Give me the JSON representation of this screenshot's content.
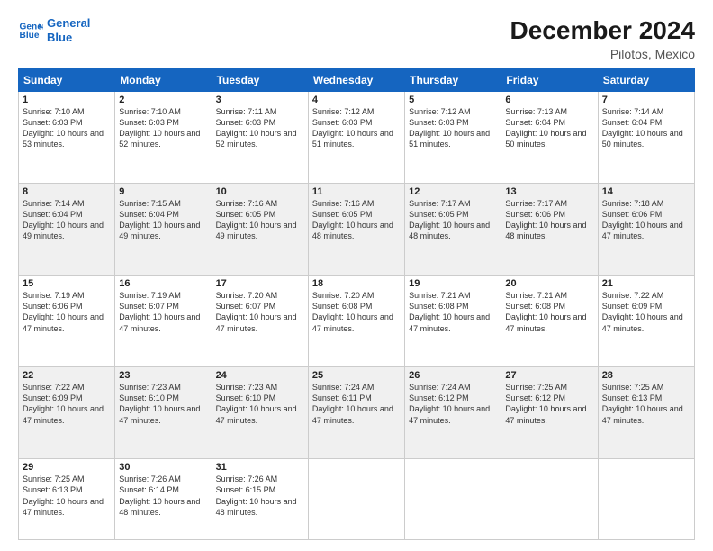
{
  "header": {
    "logo_line1": "General",
    "logo_line2": "Blue",
    "title": "December 2024",
    "subtitle": "Pilotos, Mexico"
  },
  "weekdays": [
    "Sunday",
    "Monday",
    "Tuesday",
    "Wednesday",
    "Thursday",
    "Friday",
    "Saturday"
  ],
  "weeks": [
    [
      {
        "day": "1",
        "sunrise": "7:10 AM",
        "sunset": "6:03 PM",
        "daylight": "10 hours and 53 minutes."
      },
      {
        "day": "2",
        "sunrise": "7:10 AM",
        "sunset": "6:03 PM",
        "daylight": "10 hours and 52 minutes."
      },
      {
        "day": "3",
        "sunrise": "7:11 AM",
        "sunset": "6:03 PM",
        "daylight": "10 hours and 52 minutes."
      },
      {
        "day": "4",
        "sunrise": "7:12 AM",
        "sunset": "6:03 PM",
        "daylight": "10 hours and 51 minutes."
      },
      {
        "day": "5",
        "sunrise": "7:12 AM",
        "sunset": "6:03 PM",
        "daylight": "10 hours and 51 minutes."
      },
      {
        "day": "6",
        "sunrise": "7:13 AM",
        "sunset": "6:04 PM",
        "daylight": "10 hours and 50 minutes."
      },
      {
        "day": "7",
        "sunrise": "7:14 AM",
        "sunset": "6:04 PM",
        "daylight": "10 hours and 50 minutes."
      }
    ],
    [
      {
        "day": "8",
        "sunrise": "7:14 AM",
        "sunset": "6:04 PM",
        "daylight": "10 hours and 49 minutes."
      },
      {
        "day": "9",
        "sunrise": "7:15 AM",
        "sunset": "6:04 PM",
        "daylight": "10 hours and 49 minutes."
      },
      {
        "day": "10",
        "sunrise": "7:16 AM",
        "sunset": "6:05 PM",
        "daylight": "10 hours and 49 minutes."
      },
      {
        "day": "11",
        "sunrise": "7:16 AM",
        "sunset": "6:05 PM",
        "daylight": "10 hours and 48 minutes."
      },
      {
        "day": "12",
        "sunrise": "7:17 AM",
        "sunset": "6:05 PM",
        "daylight": "10 hours and 48 minutes."
      },
      {
        "day": "13",
        "sunrise": "7:17 AM",
        "sunset": "6:06 PM",
        "daylight": "10 hours and 48 minutes."
      },
      {
        "day": "14",
        "sunrise": "7:18 AM",
        "sunset": "6:06 PM",
        "daylight": "10 hours and 47 minutes."
      }
    ],
    [
      {
        "day": "15",
        "sunrise": "7:19 AM",
        "sunset": "6:06 PM",
        "daylight": "10 hours and 47 minutes."
      },
      {
        "day": "16",
        "sunrise": "7:19 AM",
        "sunset": "6:07 PM",
        "daylight": "10 hours and 47 minutes."
      },
      {
        "day": "17",
        "sunrise": "7:20 AM",
        "sunset": "6:07 PM",
        "daylight": "10 hours and 47 minutes."
      },
      {
        "day": "18",
        "sunrise": "7:20 AM",
        "sunset": "6:08 PM",
        "daylight": "10 hours and 47 minutes."
      },
      {
        "day": "19",
        "sunrise": "7:21 AM",
        "sunset": "6:08 PM",
        "daylight": "10 hours and 47 minutes."
      },
      {
        "day": "20",
        "sunrise": "7:21 AM",
        "sunset": "6:08 PM",
        "daylight": "10 hours and 47 minutes."
      },
      {
        "day": "21",
        "sunrise": "7:22 AM",
        "sunset": "6:09 PM",
        "daylight": "10 hours and 47 minutes."
      }
    ],
    [
      {
        "day": "22",
        "sunrise": "7:22 AM",
        "sunset": "6:09 PM",
        "daylight": "10 hours and 47 minutes."
      },
      {
        "day": "23",
        "sunrise": "7:23 AM",
        "sunset": "6:10 PM",
        "daylight": "10 hours and 47 minutes."
      },
      {
        "day": "24",
        "sunrise": "7:23 AM",
        "sunset": "6:10 PM",
        "daylight": "10 hours and 47 minutes."
      },
      {
        "day": "25",
        "sunrise": "7:24 AM",
        "sunset": "6:11 PM",
        "daylight": "10 hours and 47 minutes."
      },
      {
        "day": "26",
        "sunrise": "7:24 AM",
        "sunset": "6:12 PM",
        "daylight": "10 hours and 47 minutes."
      },
      {
        "day": "27",
        "sunrise": "7:25 AM",
        "sunset": "6:12 PM",
        "daylight": "10 hours and 47 minutes."
      },
      {
        "day": "28",
        "sunrise": "7:25 AM",
        "sunset": "6:13 PM",
        "daylight": "10 hours and 47 minutes."
      }
    ],
    [
      {
        "day": "29",
        "sunrise": "7:25 AM",
        "sunset": "6:13 PM",
        "daylight": "10 hours and 47 minutes."
      },
      {
        "day": "30",
        "sunrise": "7:26 AM",
        "sunset": "6:14 PM",
        "daylight": "10 hours and 48 minutes."
      },
      {
        "day": "31",
        "sunrise": "7:26 AM",
        "sunset": "6:15 PM",
        "daylight": "10 hours and 48 minutes."
      },
      null,
      null,
      null,
      null
    ]
  ]
}
